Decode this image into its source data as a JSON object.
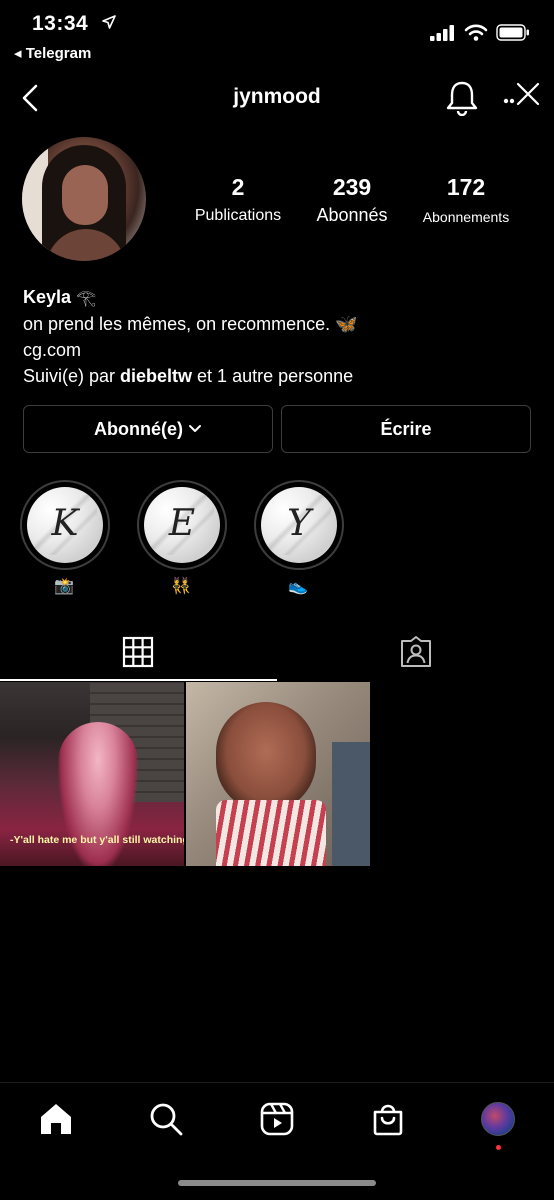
{
  "status_bar": {
    "time": "13:34",
    "back_app": "◂ Telegram"
  },
  "header": {
    "username": "jynmood"
  },
  "profile": {
    "stats": [
      {
        "value": "2",
        "label": "Publications"
      },
      {
        "value": "239",
        "label": "Abonnés"
      },
      {
        "value": "172",
        "label": "Abonnements"
      }
    ],
    "bio": {
      "name": "Keyla",
      "name_emoji": "𓂀",
      "line1": "on prend les mêmes, on recommence. 🦋",
      "link": "cg.com",
      "followed_prefix": "Suivi(e) par ",
      "followed_user": "diebeltw",
      "followed_suffix": " et 1 autre personne"
    }
  },
  "buttons": {
    "following": "Abonné(e)",
    "message": "Écrire"
  },
  "highlights": [
    {
      "letter": "K",
      "emoji": "📸"
    },
    {
      "letter": "E",
      "emoji": "👯"
    },
    {
      "letter": "Y",
      "emoji": "👟"
    }
  ],
  "posts": [
    {
      "caption": "-Y'all hate me but y'all still watching"
    },
    {
      "caption": ""
    }
  ]
}
